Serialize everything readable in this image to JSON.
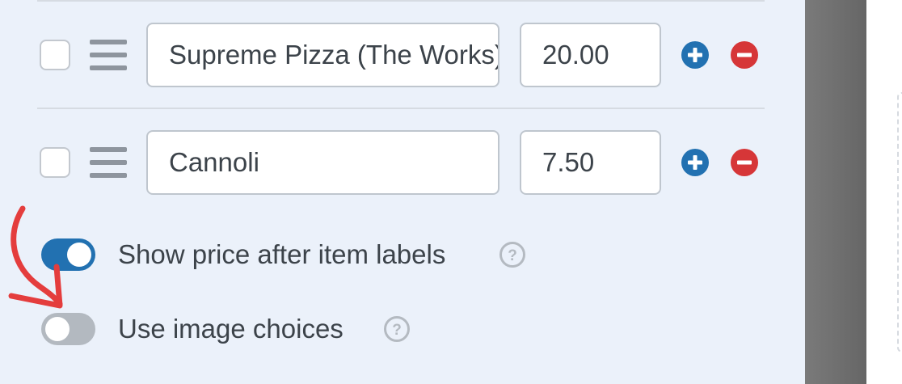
{
  "choices": [
    {
      "label": "Supreme Pizza (The Works)",
      "price": "20.00"
    },
    {
      "label": "Cannoli",
      "price": "7.50"
    }
  ],
  "toggles": {
    "show_price": {
      "label": "Show price after item labels",
      "enabled": true
    },
    "image_choices": {
      "label": "Use image choices",
      "enabled": false
    }
  },
  "icons": {
    "add": "plus-circle-icon",
    "remove": "minus-circle-icon",
    "drag": "drag-handle-icon",
    "help": "question-circle-icon"
  },
  "colors": {
    "add_button": "#2271b1",
    "remove_button": "#d63638",
    "toggle_on": "#2271b1",
    "toggle_off": "#b3b9c0",
    "annotation_arrow": "#e43d3d",
    "panel_background": "#ebf1fa"
  }
}
